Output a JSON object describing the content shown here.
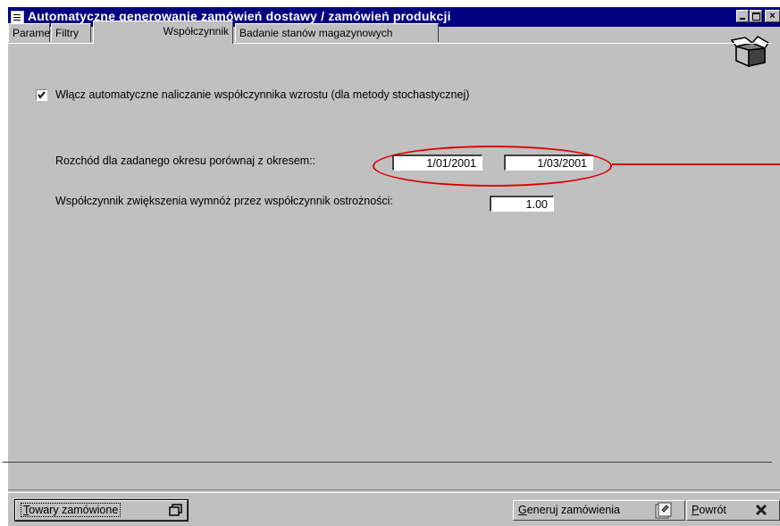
{
  "window": {
    "title": "Automatyczne generowanie zamówień dostawy / zamówień produkcji"
  },
  "tabs": [
    {
      "label": "Parametry",
      "active": false
    },
    {
      "label": "Filtry",
      "active": false
    },
    {
      "label": "Współczynnik",
      "active": true
    },
    {
      "label": "Badanie stanów magazynowych",
      "active": false
    }
  ],
  "settings": {
    "auto_checkbox": {
      "label": "Włącz automatyczne naliczanie współczynnika wzrostu (dla metody stochastycznej)",
      "checked": true
    },
    "compare": {
      "label": "Rozchód dla zadanego okresu porównaj z okresem::",
      "date_from": "1/01/2001",
      "date_to": "1/03/2001"
    },
    "multiplier": {
      "label": "Współczynnik zwiększenia wymnóż przez współczynnik ostrożności:",
      "value": "1.00"
    }
  },
  "buttons": {
    "towary": {
      "hot": "T",
      "rest": "owary zamówione"
    },
    "generuj": {
      "hot": "G",
      "rest": "eneruj zamówienia"
    },
    "powrot": {
      "hot": "P",
      "rest": "owrót"
    }
  },
  "colors": {
    "titlebar": "#000080",
    "face": "#c0c0c0",
    "annotation": "#e00000"
  }
}
